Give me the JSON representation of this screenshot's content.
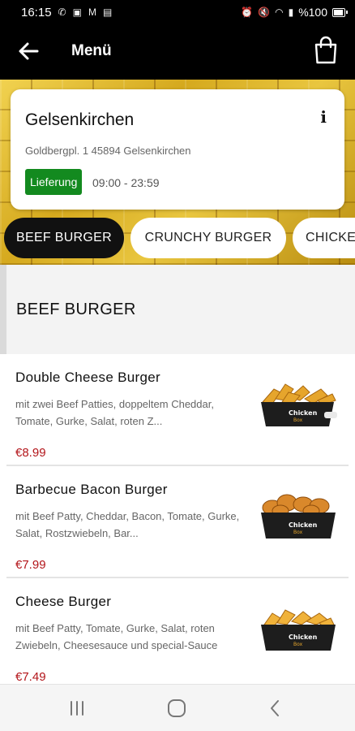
{
  "status_bar": {
    "time": "16:15",
    "battery": "%100",
    "battery_level": 1.0,
    "left_icons": [
      "whatsapp-icon",
      "gallery-icon",
      "m-icon",
      "box-icon"
    ],
    "right_icons": [
      "alarm-icon",
      "mute-icon",
      "wifi-icon",
      "signal-icon"
    ]
  },
  "header": {
    "title": "Menü",
    "back_icon": "arrow-left-icon",
    "cart_icon": "shopping-bag-icon"
  },
  "store": {
    "name": "Gelsenkirchen",
    "address": "Goldbergpl. 1 45894 Gelsenkirchen",
    "delivery_label": "Lieferung",
    "delivery_color": "#138a1f",
    "hours": "09:00 - 23:59",
    "info_icon": "info-icon"
  },
  "categories": [
    {
      "label": "BEEF BURGER",
      "active": true
    },
    {
      "label": "CRUNCHY BURGER",
      "active": false
    },
    {
      "label": "CHICKEN",
      "active": false
    }
  ],
  "section": {
    "title": "BEEF BURGER"
  },
  "items": [
    {
      "name": "Double Cheese Burger",
      "description": "mit zwei Beef Patties, doppeltem Cheddar, Tomate, Gurke, Salat, roten Z...",
      "price": "€8.99",
      "image_icon": "chicken-box-fries-image"
    },
    {
      "name": "Barbecue Bacon Burger",
      "description": "mit Beef Patty, Cheddar, Bacon, Tomate, Gurke, Salat, Rostzwiebeln, Bar...",
      "price": "€7.99",
      "image_icon": "chicken-box-wings-image"
    },
    {
      "name": "Cheese Burger",
      "description": "mit Beef Patty, Tomate, Gurke, Salat, roten Zwiebeln, Cheesesauce und special-Sauce",
      "price": "€7.49",
      "image_icon": "chicken-box-fries-image"
    }
  ],
  "colors": {
    "accent": "#111111",
    "price": "#b3151a",
    "brick": "#c9a218"
  },
  "nav": {
    "recents_icon": "recents-icon",
    "home_icon": "home-icon",
    "back_icon": "back-chevron-icon"
  }
}
